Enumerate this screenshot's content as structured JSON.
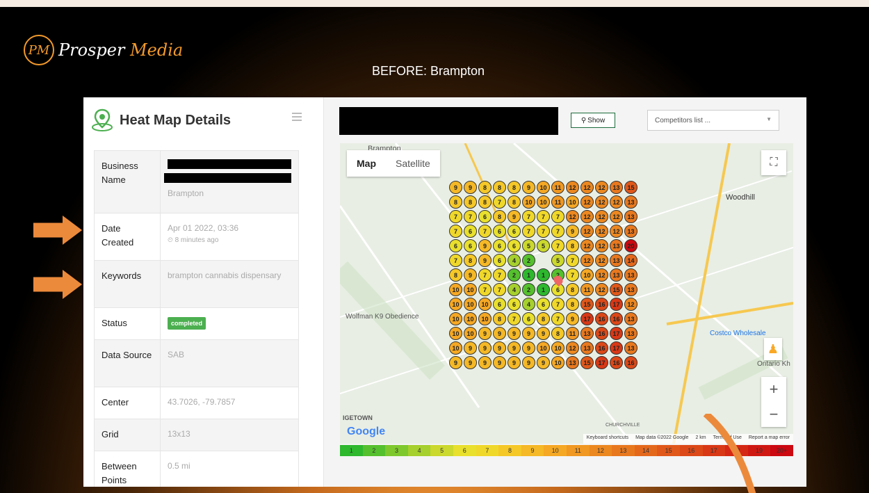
{
  "brand": {
    "mark": "PM",
    "name_a": "Prosper ",
    "name_b": "Media"
  },
  "slide_title": "BEFORE: Brampton",
  "panel": {
    "title": "Heat Map Details",
    "rows": [
      {
        "label": "Business Name",
        "value": "Brampton"
      },
      {
        "label": "Date Created",
        "value": "Apr 01 2022, 03:36",
        "sub": "⏲ 8 minutes ago"
      },
      {
        "label": "Keywords",
        "value": "brampton cannabis dispensary"
      },
      {
        "label": "Status",
        "value": "completed"
      },
      {
        "label": "Data Source",
        "value": "SAB"
      },
      {
        "label": "Center",
        "value": "43.7026, -79.7857"
      },
      {
        "label": "Grid",
        "value": "13x13"
      },
      {
        "label": "Between Points",
        "value": "0.5 mi"
      }
    ]
  },
  "toolbar": {
    "show_label": "Show",
    "competitors_placeholder": "Competitors list ..."
  },
  "map": {
    "type_map": "Map",
    "type_satellite": "Satellite",
    "labels": {
      "brampton": "Brampton",
      "woodhill": "Woodhill",
      "wolfman": "Wolfman K9 Obedience",
      "costco": "Costco Wholesale",
      "ontario": "Ontario Kh",
      "igetown": "IGETOWN",
      "churchville": "CHURCHVILLE"
    },
    "google": "Google",
    "attribution": {
      "shortcuts": "Keyboard shortcuts",
      "mapdata": "Map data ©2022 Google",
      "scale": "2 km",
      "terms": "Terms of Use",
      "report": "Report a map error"
    }
  },
  "heatmap": {
    "grid": [
      [
        9,
        9,
        8,
        8,
        8,
        9,
        10,
        11,
        12,
        12,
        12,
        13,
        15
      ],
      [
        8,
        8,
        8,
        7,
        8,
        10,
        10,
        11,
        10,
        12,
        12,
        12,
        13
      ],
      [
        7,
        7,
        6,
        8,
        9,
        7,
        7,
        7,
        12,
        12,
        12,
        12,
        13
      ],
      [
        7,
        6,
        7,
        6,
        6,
        7,
        7,
        7,
        9,
        12,
        12,
        12,
        13
      ],
      [
        6,
        6,
        9,
        6,
        6,
        5,
        5,
        7,
        8,
        12,
        12,
        13,
        20
      ],
      [
        7,
        8,
        9,
        6,
        4,
        2,
        null,
        5,
        7,
        12,
        12,
        13,
        14
      ],
      [
        8,
        9,
        7,
        7,
        2,
        1,
        1,
        2,
        7,
        10,
        12,
        13,
        13
      ],
      [
        10,
        10,
        7,
        7,
        4,
        2,
        1,
        6,
        8,
        11,
        12,
        15,
        13
      ],
      [
        10,
        10,
        10,
        6,
        6,
        4,
        6,
        7,
        8,
        15,
        16,
        17,
        12
      ],
      [
        10,
        10,
        10,
        8,
        7,
        6,
        8,
        7,
        9,
        17,
        16,
        16,
        13
      ],
      [
        10,
        10,
        9,
        9,
        9,
        9,
        9,
        8,
        11,
        13,
        16,
        17,
        13
      ],
      [
        10,
        9,
        9,
        9,
        9,
        9,
        10,
        10,
        12,
        13,
        16,
        17,
        13
      ],
      [
        9,
        9,
        9,
        9,
        9,
        9,
        9,
        10,
        13,
        15,
        17,
        16,
        16
      ]
    ],
    "legend": [
      "1",
      "2",
      "3",
      "4",
      "5",
      "6",
      "7",
      "8",
      "9",
      "10",
      "11",
      "12",
      "13",
      "14",
      "15",
      "16",
      "17",
      "18",
      "19",
      "20+"
    ],
    "legend_colors": [
      "#2db82d",
      "#55c02d",
      "#7ec82d",
      "#a6d02d",
      "#cbd82d",
      "#e8e02d",
      "#f0d82a",
      "#f5c828",
      "#f5b826",
      "#f5a824",
      "#f09822",
      "#ec8820",
      "#e8781e",
      "#e4681c",
      "#e0581a",
      "#dc4818",
      "#d83816",
      "#d42814",
      "#d01812",
      "#cc0810"
    ]
  }
}
